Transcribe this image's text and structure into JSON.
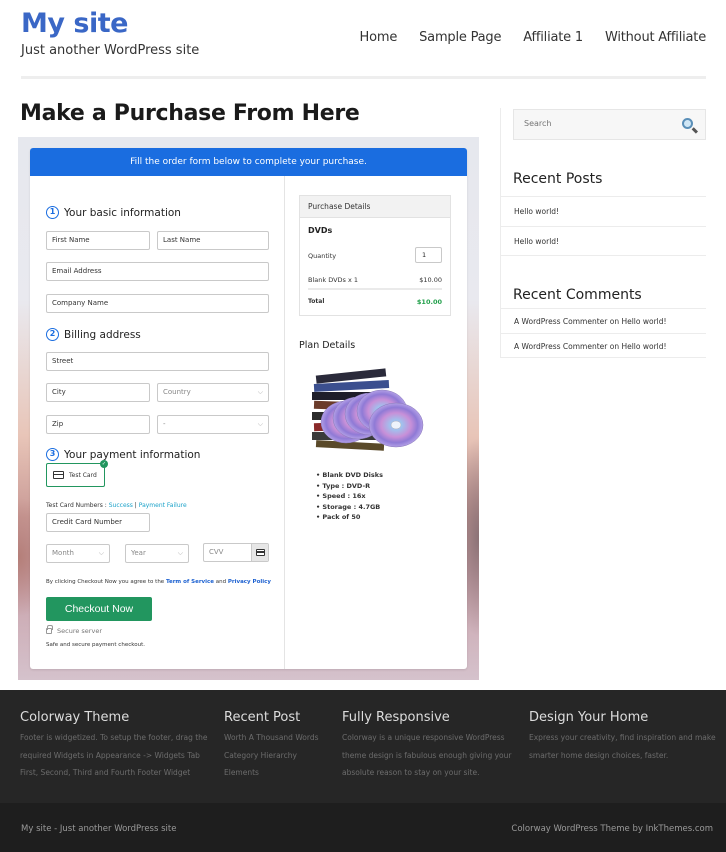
{
  "header": {
    "site_title": "My site",
    "tagline": "Just another WordPress site",
    "nav": [
      "Home",
      "Sample Page",
      "Affiliate 1",
      "Without Affiliate"
    ]
  },
  "main": {
    "page_title": "Make a Purchase From Here",
    "form": {
      "banner": "Fill the order form below to complete your purchase.",
      "sections": [
        {
          "number": "1",
          "title": "Your basic information"
        },
        {
          "number": "2",
          "title": "Billing address"
        },
        {
          "number": "3",
          "title": "Your payment information"
        }
      ],
      "fields": {
        "first_name": "First Name",
        "last_name": "Last Name",
        "email": "Email Address",
        "company": "Company Name",
        "street": "Street",
        "city": "City",
        "country": "Country",
        "zip": "Zip",
        "state": "-",
        "credit_card": "Credit Card Number",
        "month": "Month",
        "year": "Year",
        "cvv": "CVV"
      },
      "test_card_label": "Test Card",
      "test_numbers_label": "Test Card Numbers : ",
      "test_success": "Success",
      "test_separator": " | ",
      "test_failure": "Payment Failure",
      "agree_prefix": "By clicking Checkout Now you agree to the ",
      "terms": "Term of Service",
      "agree_and": " and ",
      "privacy": "Privacy Policy",
      "checkout_button": "Checkout Now",
      "secure_server": "Secure server",
      "safe_text": "Safe and secure payment checkout."
    },
    "purchase_details": {
      "heading": "Purchase Details",
      "product": "DVDs",
      "quantity_label": "Quantity",
      "quantity_value": "1",
      "line_item": "Blank DVDs x 1",
      "line_price": "$10.00",
      "total_label": "Total",
      "total_value": "$10.00",
      "total_color": "#22a04b"
    },
    "plan_details": {
      "heading": "Plan Details",
      "features": [
        "Blank DVD Disks",
        "Type : DVD-R",
        "Speed : 16x",
        "Storage : 4.7GB",
        "Pack of 50"
      ]
    }
  },
  "sidebar": {
    "search_placeholder": "Search",
    "recent_posts_title": "Recent Posts",
    "recent_posts": [
      "Hello world!",
      "Hello world!"
    ],
    "recent_comments_title": "Recent Comments",
    "recent_comments": [
      "A WordPress Commenter on Hello world!",
      "A WordPress Commenter on Hello world!"
    ]
  },
  "footer": {
    "columns": [
      {
        "title": "Colorway Theme",
        "lines": [
          "Footer is widgetized. To setup the footer, drag the",
          "required Widgets in Appearance -> Widgets Tab",
          "First, Second, Third and Fourth Footer Widget"
        ]
      },
      {
        "title": "Recent Post",
        "lines": [
          "Worth A Thousand Words",
          "Category Hierarchy",
          "Elements"
        ]
      },
      {
        "title": "Fully Responsive",
        "lines": [
          "Colorway is a unique responsive WordPress",
          "theme design is fabulous enough giving your",
          "absolute reason to stay on your site."
        ]
      },
      {
        "title": "Design Your Home",
        "lines": [
          "Express your creativity, find inspiration and make",
          "smarter home design choices, faster."
        ]
      }
    ],
    "bottom_left": "My site - Just another WordPress site",
    "bottom_right": "Colorway WordPress Theme by InkThemes.com"
  },
  "colors": {
    "brand_blue": "#3a67c6",
    "banner_blue": "#1a6de0",
    "checkout_green": "#22965f",
    "footer_bg": "#262626"
  }
}
